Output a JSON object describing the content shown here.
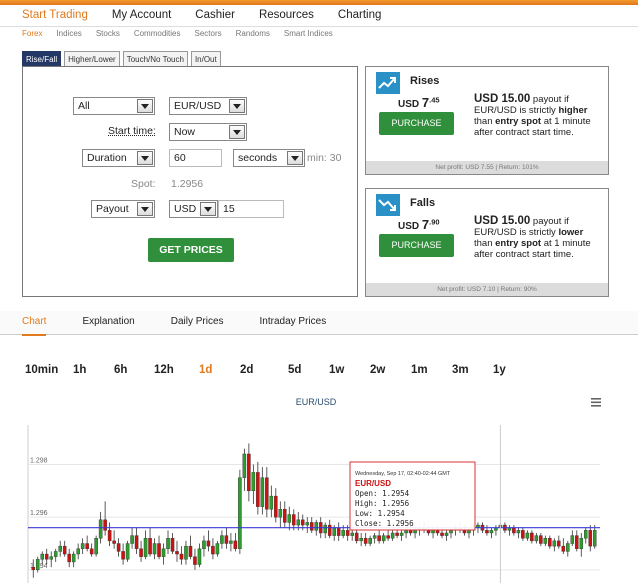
{
  "main_nav": [
    "Start Trading",
    "My Account",
    "Cashier",
    "Resources",
    "Charting"
  ],
  "sub_nav": [
    "Forex",
    "Indices",
    "Stocks",
    "Commodities",
    "Sectors",
    "Randoms",
    "Smart Indices"
  ],
  "contract_tabs": [
    "Rise/Fall",
    "Higher/Lower",
    "Touch/No Touch",
    "In/Out"
  ],
  "form": {
    "market": "All",
    "symbol": "EUR/USD",
    "start_time_label": "Start time:",
    "start_time": "Now",
    "duration_type": "Duration",
    "duration_value": "60",
    "duration_unit": "seconds",
    "duration_min": "min: 30",
    "spot_label": "Spot:",
    "spot_value": "1.2956",
    "payout_type": "Payout",
    "currency": "USD",
    "amount": "15",
    "get_prices": "GET PRICES"
  },
  "rises": {
    "title": "Rises",
    "price_currency": "USD",
    "price_main": "7",
    "price_dec": ".45",
    "button": "PURCHASE",
    "desc_amount": "USD 15.00",
    "desc_1": " payout if EUR/USD is strictly ",
    "desc_dir": "higher",
    "desc_2": " than ",
    "desc_entry": "entry spot",
    "desc_3": " at 1 minute after contract start time.",
    "footer": "Net profit: USD 7.55 | Return: 101%"
  },
  "falls": {
    "title": "Falls",
    "price_currency": "USD",
    "price_main": "7",
    "price_dec": ".90",
    "button": "PURCHASE",
    "desc_amount": "USD 15.00",
    "desc_1": " payout if EUR/USD is strictly ",
    "desc_dir": "lower",
    "desc_2": " than ",
    "desc_entry": "entry spot",
    "desc_3": " at 1 minute after contract start time.",
    "footer": "Net profit: USD 7.10 | Return: 90%"
  },
  "panel_tabs": [
    "Chart",
    "Explanation",
    "Daily Prices",
    "Intraday Prices"
  ],
  "periods": [
    "10min",
    "1h",
    "6h",
    "12h",
    "1d",
    "2d",
    "5d",
    "1w",
    "2w",
    "1m",
    "3m",
    "1y"
  ],
  "active_period": "1d",
  "colors": {
    "accent": "#e07a1f",
    "button_green": "#2f8f3a",
    "nav_dark": "#233864",
    "candle_up": "#2e9d2e",
    "candle_down": "#cc1111",
    "spot_line": "#3a3ad8"
  },
  "chart_data": {
    "type": "candlestick",
    "title": "EUR/USD",
    "yticks": [
      "1.298",
      "1.296",
      "1.294"
    ],
    "ylim": [
      1.2935,
      1.2995
    ],
    "spot_line": 1.2956,
    "crosshair_index": 104,
    "candles_ohlc": [
      [
        1.2941,
        1.2944,
        1.2937,
        1.294
      ],
      [
        1.294,
        1.2945,
        1.2939,
        1.2944
      ],
      [
        1.2944,
        1.2947,
        1.2942,
        1.2946
      ],
      [
        1.2946,
        1.2948,
        1.2942,
        1.2944
      ],
      [
        1.2944,
        1.2947,
        1.2941,
        1.2945
      ],
      [
        1.2945,
        1.2948,
        1.2943,
        1.2947
      ],
      [
        1.2947,
        1.2951,
        1.2945,
        1.2949
      ],
      [
        1.2949,
        1.2951,
        1.2945,
        1.2946
      ],
      [
        1.2946,
        1.2948,
        1.2941,
        1.2943
      ],
      [
        1.2943,
        1.2947,
        1.2941,
        1.2946
      ],
      [
        1.2946,
        1.295,
        1.2944,
        1.2948
      ],
      [
        1.2948,
        1.2952,
        1.2946,
        1.295
      ],
      [
        1.295,
        1.2953,
        1.2947,
        1.2948
      ],
      [
        1.2948,
        1.295,
        1.2945,
        1.2946
      ],
      [
        1.2946,
        1.2953,
        1.2945,
        1.2952
      ],
      [
        1.2952,
        1.2962,
        1.295,
        1.2959
      ],
      [
        1.2959,
        1.2966,
        1.2953,
        1.2955
      ],
      [
        1.2955,
        1.2958,
        1.2949,
        1.2951
      ],
      [
        1.2951,
        1.2955,
        1.2948,
        1.295
      ],
      [
        1.295,
        1.2952,
        1.2945,
        1.2947
      ],
      [
        1.2947,
        1.295,
        1.2942,
        1.2944
      ],
      [
        1.2944,
        1.2951,
        1.2943,
        1.295
      ],
      [
        1.295,
        1.2956,
        1.2948,
        1.2953
      ],
      [
        1.2953,
        1.2956,
        1.2946,
        1.2948
      ],
      [
        1.2948,
        1.2951,
        1.2943,
        1.2945
      ],
      [
        1.2945,
        1.2955,
        1.2944,
        1.2952
      ],
      [
        1.2952,
        1.2956,
        1.2945,
        1.2946
      ],
      [
        1.2946,
        1.2952,
        1.2944,
        1.295
      ],
      [
        1.295,
        1.2953,
        1.2944,
        1.2945
      ],
      [
        1.2945,
        1.295,
        1.2942,
        1.2948
      ],
      [
        1.2948,
        1.2955,
        1.2946,
        1.2952
      ],
      [
        1.2952,
        1.2954,
        1.2946,
        1.2947
      ],
      [
        1.2947,
        1.2951,
        1.2943,
        1.2946
      ],
      [
        1.2946,
        1.2949,
        1.2942,
        1.2944
      ],
      [
        1.2944,
        1.2951,
        1.2942,
        1.2949
      ],
      [
        1.2949,
        1.2953,
        1.2944,
        1.2945
      ],
      [
        1.2945,
        1.2948,
        1.294,
        1.2942
      ],
      [
        1.2942,
        1.295,
        1.2941,
        1.2948
      ],
      [
        1.2948,
        1.2953,
        1.2945,
        1.2951
      ],
      [
        1.2951,
        1.2955,
        1.2947,
        1.2949
      ],
      [
        1.2949,
        1.2952,
        1.2944,
        1.2946
      ],
      [
        1.2946,
        1.2951,
        1.2945,
        1.295
      ],
      [
        1.295,
        1.2955,
        1.2948,
        1.2953
      ],
      [
        1.2953,
        1.2956,
        1.2948,
        1.295
      ],
      [
        1.295,
        1.2954,
        1.2947,
        1.2951
      ],
      [
        1.2951,
        1.2954,
        1.2947,
        1.2948
      ],
      [
        1.2948,
        1.2978,
        1.2946,
        1.2975
      ],
      [
        1.2975,
        1.2986,
        1.297,
        1.2984
      ],
      [
        1.2984,
        1.2988,
        1.2966,
        1.297
      ],
      [
        1.297,
        1.298,
        1.2965,
        1.2977
      ],
      [
        1.2977,
        1.2981,
        1.2961,
        1.2964
      ],
      [
        1.2964,
        1.2979,
        1.2961,
        1.2975
      ],
      [
        1.2975,
        1.2979,
        1.296,
        1.2963
      ],
      [
        1.2963,
        1.2972,
        1.296,
        1.2968
      ],
      [
        1.2968,
        1.2971,
        1.2958,
        1.296
      ],
      [
        1.296,
        1.2966,
        1.2956,
        1.2963
      ],
      [
        1.2963,
        1.2966,
        1.2956,
        1.2958
      ],
      [
        1.2958,
        1.2964,
        1.2955,
        1.2961
      ],
      [
        1.2961,
        1.2963,
        1.2955,
        1.2957
      ],
      [
        1.2957,
        1.2962,
        1.2955,
        1.2959
      ],
      [
        1.2959,
        1.2961,
        1.2955,
        1.2957
      ],
      [
        1.2957,
        1.296,
        1.2954,
        1.2958
      ],
      [
        1.2958,
        1.296,
        1.2954,
        1.2955
      ],
      [
        1.2955,
        1.2959,
        1.2953,
        1.2958
      ],
      [
        1.2958,
        1.296,
        1.2952,
        1.2954
      ],
      [
        1.2954,
        1.2958,
        1.2952,
        1.2957
      ],
      [
        1.2957,
        1.2959,
        1.2952,
        1.2953
      ],
      [
        1.2953,
        1.2957,
        1.2951,
        1.2956
      ],
      [
        1.2956,
        1.2958,
        1.2951,
        1.2953
      ],
      [
        1.2953,
        1.2957,
        1.2952,
        1.2955
      ],
      [
        1.2955,
        1.2957,
        1.2951,
        1.2953
      ],
      [
        1.2953,
        1.2956,
        1.2951,
        1.2954
      ],
      [
        1.2954,
        1.2956,
        1.295,
        1.2951
      ],
      [
        1.2951,
        1.2954,
        1.2949,
        1.2952
      ],
      [
        1.2952,
        1.2954,
        1.2949,
        1.295
      ],
      [
        1.295,
        1.2953,
        1.2949,
        1.2952
      ],
      [
        1.2952,
        1.2954,
        1.295,
        1.2953
      ],
      [
        1.2953,
        1.2955,
        1.295,
        1.2951
      ],
      [
        1.2951,
        1.2954,
        1.295,
        1.2953
      ],
      [
        1.2953,
        1.2955,
        1.2951,
        1.2952
      ],
      [
        1.2952,
        1.2955,
        1.2951,
        1.2954
      ],
      [
        1.2954,
        1.2956,
        1.2952,
        1.2953
      ],
      [
        1.2953,
        1.2955,
        1.2951,
        1.2954
      ],
      [
        1.2954,
        1.2956,
        1.2952,
        1.2955
      ],
      [
        1.2955,
        1.2957,
        1.2953,
        1.2954
      ],
      [
        1.2954,
        1.2956,
        1.2952,
        1.2955
      ],
      [
        1.2955,
        1.2957,
        1.2953,
        1.2956
      ],
      [
        1.2956,
        1.2958,
        1.2954,
        1.2955
      ],
      [
        1.2955,
        1.2957,
        1.2953,
        1.2954
      ],
      [
        1.2954,
        1.2956,
        1.2952,
        1.2955
      ],
      [
        1.2955,
        1.2957,
        1.2953,
        1.2954
      ],
      [
        1.2954,
        1.2956,
        1.2952,
        1.2953
      ],
      [
        1.2953,
        1.2955,
        1.2951,
        1.2954
      ],
      [
        1.2954,
        1.2956,
        1.2952,
        1.2955
      ],
      [
        1.2955,
        1.2957,
        1.2953,
        1.2956
      ],
      [
        1.2956,
        1.2958,
        1.2954,
        1.2955
      ],
      [
        1.2955,
        1.2957,
        1.2953,
        1.2954
      ],
      [
        1.2954,
        1.2956,
        1.2952,
        1.2955
      ],
      [
        1.2955,
        1.2957,
        1.2953,
        1.2956
      ],
      [
        1.2956,
        1.2958,
        1.2954,
        1.2957
      ],
      [
        1.2957,
        1.2958,
        1.2954,
        1.2955
      ],
      [
        1.2955,
        1.2957,
        1.2953,
        1.2954
      ],
      [
        1.2954,
        1.2956,
        1.2952,
        1.2955
      ],
      [
        1.2955,
        1.2957,
        1.2953,
        1.2956
      ],
      [
        1.2956,
        1.2958,
        1.2954,
        1.2957
      ],
      [
        1.2957,
        1.2958,
        1.2954,
        1.2955
      ],
      [
        1.2955,
        1.2957,
        1.2953,
        1.2956
      ],
      [
        1.2956,
        1.2957,
        1.2953,
        1.2954
      ],
      [
        1.2954,
        1.2956,
        1.2952,
        1.2955
      ],
      [
        1.2955,
        1.2956,
        1.2951,
        1.2952
      ],
      [
        1.2952,
        1.2955,
        1.2951,
        1.2954
      ],
      [
        1.2954,
        1.2955,
        1.295,
        1.2951
      ],
      [
        1.2951,
        1.2954,
        1.295,
        1.2953
      ],
      [
        1.2953,
        1.2954,
        1.2949,
        1.295
      ],
      [
        1.295,
        1.2953,
        1.2949,
        1.2952
      ],
      [
        1.2952,
        1.2953,
        1.2948,
        1.2949
      ],
      [
        1.2949,
        1.2952,
        1.2947,
        1.2951
      ],
      [
        1.2951,
        1.2953,
        1.2948,
        1.2949
      ],
      [
        1.2949,
        1.2952,
        1.2946,
        1.2947
      ],
      [
        1.2947,
        1.2951,
        1.2945,
        1.295
      ],
      [
        1.295,
        1.2955,
        1.2949,
        1.2953
      ],
      [
        1.2953,
        1.2955,
        1.2947,
        1.2948
      ],
      [
        1.2948,
        1.2954,
        1.2945,
        1.2952
      ],
      [
        1.2952,
        1.2956,
        1.295,
        1.2955
      ],
      [
        1.2955,
        1.2957,
        1.2947,
        1.2949
      ],
      [
        1.2949,
        1.2957,
        1.2948,
        1.2955
      ]
    ],
    "tooltip": {
      "date": "Wednesday, Sep 17, 02:40-02:44 GMT",
      "symbol": "EUR/USD",
      "open": "Open: 1.2954",
      "high": "High: 1.2956",
      "low": "Low: 1.2954",
      "close": "Close: 1.2956"
    }
  }
}
